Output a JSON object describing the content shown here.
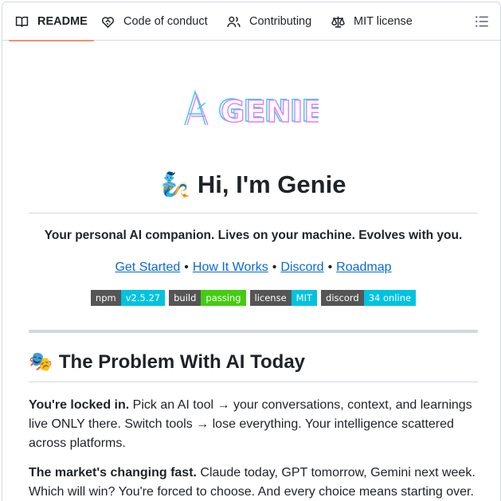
{
  "tabs": [
    {
      "label": "README",
      "icon": "book-icon",
      "active": true
    },
    {
      "label": "Code of conduct",
      "icon": "heart-handshake-icon",
      "active": false
    },
    {
      "label": "Contributing",
      "icon": "people-icon",
      "active": false
    },
    {
      "label": "MIT license",
      "icon": "scale-icon",
      "active": false
    }
  ],
  "toc_icon": "list-unordered-icon",
  "logo": {
    "text": "GENIE",
    "colors": {
      "cyan": "#22d3ee",
      "magenta": "#e879f9"
    }
  },
  "hero": {
    "emoji": "🧞",
    "title": "Hi, I'm Genie"
  },
  "tagline": "Your personal AI companion. Lives on your machine. Evolves with you.",
  "links": [
    {
      "label": "Get Started"
    },
    {
      "label": "How It Works"
    },
    {
      "label": "Discord"
    },
    {
      "label": "Roadmap"
    }
  ],
  "link_separator": "•",
  "badges": [
    {
      "key": "npm",
      "value": "v2.5.27",
      "color": "#00c2e0"
    },
    {
      "key": "build",
      "value": "passing",
      "color": "#4c1"
    },
    {
      "key": "license",
      "value": "MIT",
      "color": "#00c2e0"
    },
    {
      "key": "discord",
      "value": "34 online",
      "color": "#00c2e0"
    }
  ],
  "section": {
    "emoji": "🎭",
    "heading": "The Problem With AI Today"
  },
  "paragraphs": [
    {
      "lead": "You're locked in.",
      "line1": "Pick an AI tool → your conversations, context, and learnings",
      "line2": "live ONLY there. Switch tools → lose everything. Your intelligence scattered",
      "line3": "across platforms."
    },
    {
      "lead": "The market's changing fast.",
      "line1": "Claude today, GPT tomorrow, Gemini next week.",
      "line2": "Which will win? You're forced to choose. And every choice means starting over."
    }
  ]
}
